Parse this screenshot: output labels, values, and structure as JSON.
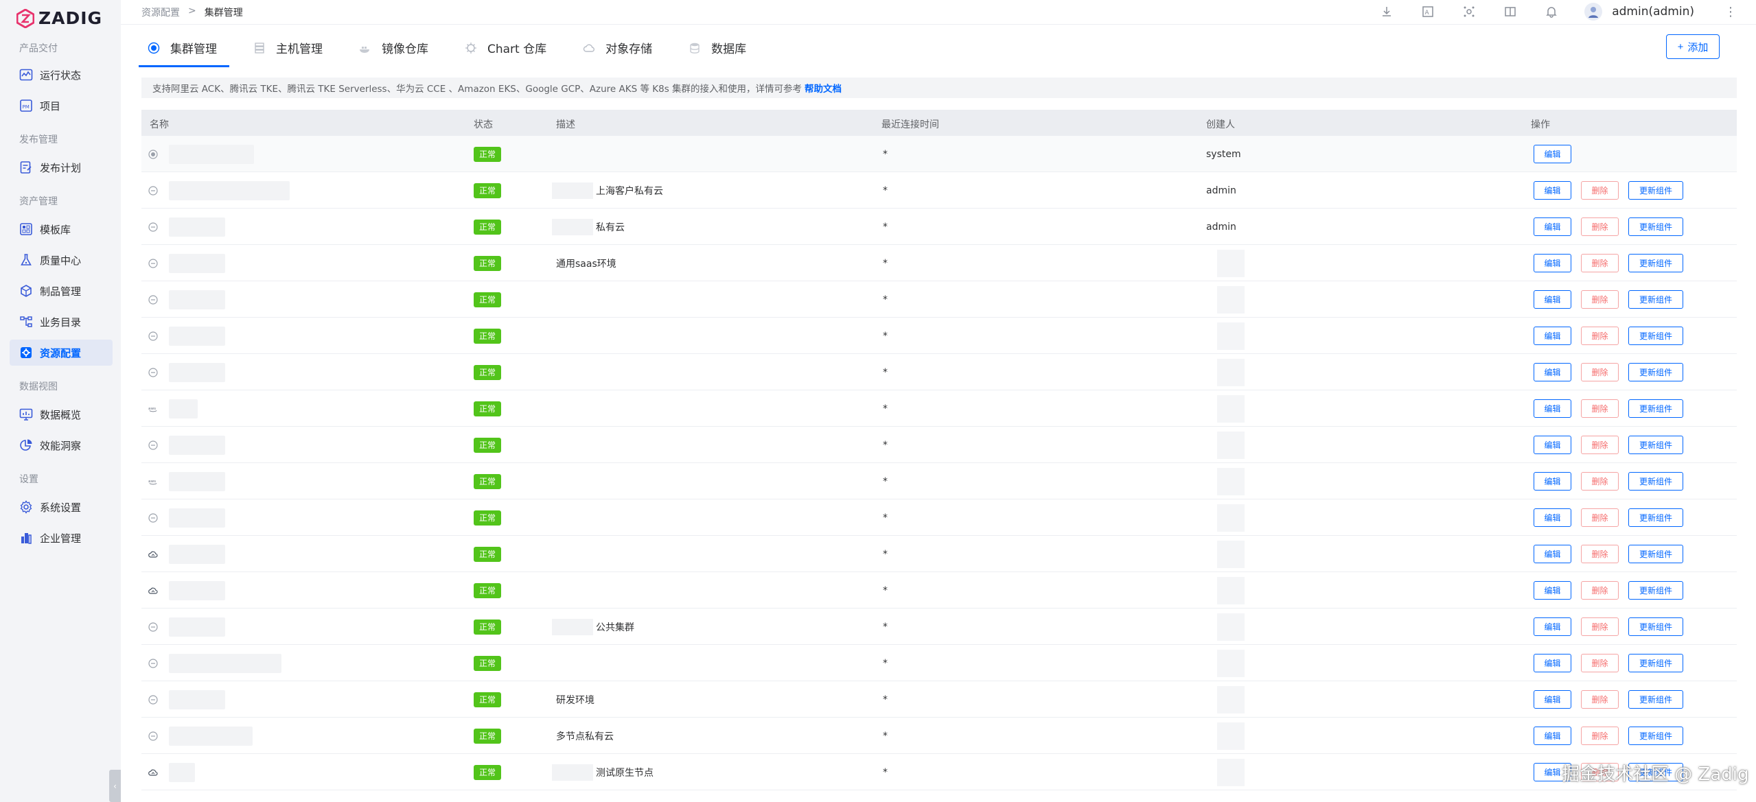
{
  "brand": {
    "name": "ZADIG"
  },
  "sidebar": {
    "sections": [
      {
        "label": "产品交付",
        "items": [
          {
            "label": "运行状态",
            "icon": "activity-icon"
          },
          {
            "label": "项目",
            "icon": "project-icon"
          }
        ]
      },
      {
        "label": "发布管理",
        "items": [
          {
            "label": "发布计划",
            "icon": "release-plan-icon"
          }
        ]
      },
      {
        "label": "资产管理",
        "items": [
          {
            "label": "模板库",
            "icon": "template-icon"
          },
          {
            "label": "质量中心",
            "icon": "flask-icon"
          },
          {
            "label": "制品管理",
            "icon": "artifact-icon"
          },
          {
            "label": "业务目录",
            "icon": "catalog-icon"
          },
          {
            "label": "资源配置",
            "icon": "gear-square-icon",
            "active": true
          }
        ]
      },
      {
        "label": "数据视图",
        "items": [
          {
            "label": "数据概览",
            "icon": "chart-bar-icon"
          },
          {
            "label": "效能洞察",
            "icon": "pie-chart-icon"
          }
        ]
      },
      {
        "label": "设置",
        "items": [
          {
            "label": "系统设置",
            "icon": "settings-icon"
          },
          {
            "label": "企业管理",
            "icon": "building-icon"
          }
        ]
      }
    ]
  },
  "breadcrumb": {
    "parent": "资源配置",
    "sep": ">",
    "current": "集群管理"
  },
  "topbar": {
    "user": "admin(admin)"
  },
  "tabs": [
    {
      "label": "集群管理",
      "icon": "cluster-icon",
      "active": true
    },
    {
      "label": "主机管理",
      "icon": "server-icon"
    },
    {
      "label": "镜像仓库",
      "icon": "registry-icon"
    },
    {
      "label": "Chart 仓库",
      "icon": "helm-icon"
    },
    {
      "label": "对象存储",
      "icon": "cloud-storage-icon"
    },
    {
      "label": "数据库",
      "icon": "database-icon"
    }
  ],
  "add_button": {
    "label": "添加"
  },
  "notice": {
    "text": "支持阿里云 ACK、腾讯云 TKE、腾讯云 TKE Serverless、华为云 CCE 、Amazon EKS、Google GCP、Azure AKS 等 K8s 集群的接入和使用，详情可参考",
    "link": "帮助文档"
  },
  "table": {
    "headers": [
      "名称",
      "状态",
      "描述",
      "最近连接时间",
      "创建人",
      "操作"
    ],
    "buttons": {
      "edit": "编辑",
      "delete": "删除",
      "update": "更新组件"
    },
    "rows": [
      {
        "type": "radio",
        "status": "正常",
        "desc": "",
        "desc_blur": false,
        "time": "*",
        "creator": "system",
        "actions": "edit"
      },
      {
        "type": "minus",
        "status": "正常",
        "desc": "上海客户私有云",
        "desc_blur": true,
        "time": "*",
        "creator": "admin",
        "actions": "all"
      },
      {
        "type": "minus",
        "status": "正常",
        "desc": "私有云",
        "desc_blur": true,
        "time": "*",
        "creator": "admin",
        "actions": "all"
      },
      {
        "type": "minus",
        "status": "正常",
        "desc": "通用saas环境",
        "desc_blur": false,
        "time": "*",
        "creator": "",
        "actions": "all"
      },
      {
        "type": "minus",
        "status": "正常",
        "desc": "",
        "desc_blur": false,
        "time": "*",
        "creator": "",
        "actions": "all"
      },
      {
        "type": "minus",
        "status": "正常",
        "desc": "",
        "desc_blur": false,
        "time": "*",
        "creator": "",
        "actions": "all"
      },
      {
        "type": "minus",
        "status": "正常",
        "desc": "",
        "desc_blur": false,
        "time": "*",
        "creator": "",
        "actions": "all"
      },
      {
        "type": "aws",
        "status": "正常",
        "desc": "",
        "desc_blur": false,
        "time": "*",
        "creator": "",
        "actions": "all"
      },
      {
        "type": "minus",
        "status": "正常",
        "desc": "",
        "desc_blur": false,
        "time": "*",
        "creator": "",
        "actions": "all"
      },
      {
        "type": "aws",
        "status": "正常",
        "desc": "",
        "desc_blur": false,
        "time": "*",
        "creator": "",
        "actions": "all"
      },
      {
        "type": "minus",
        "status": "正常",
        "desc": "",
        "desc_blur": false,
        "time": "*",
        "creator": "",
        "actions": "all"
      },
      {
        "type": "cloud",
        "status": "正常",
        "desc": "",
        "desc_blur": false,
        "time": "*",
        "creator": "",
        "actions": "all"
      },
      {
        "type": "cloud",
        "status": "正常",
        "desc": "",
        "desc_blur": false,
        "time": "*",
        "creator": "",
        "actions": "all"
      },
      {
        "type": "minus",
        "status": "正常",
        "desc": "公共集群",
        "desc_blur": true,
        "time": "*",
        "creator": "",
        "actions": "all"
      },
      {
        "type": "minus",
        "status": "正常",
        "desc": "",
        "desc_blur": false,
        "time": "*",
        "creator": "",
        "actions": "all"
      },
      {
        "type": "minus",
        "status": "正常",
        "desc": "研发环境",
        "desc_blur": false,
        "time": "*",
        "creator": "",
        "actions": "all"
      },
      {
        "type": "minus",
        "status": "正常",
        "desc": "多节点私有云",
        "desc_blur": false,
        "time": "*",
        "creator": "",
        "actions": "all"
      },
      {
        "type": "cloud",
        "status": "正常",
        "desc": "测试原生节点",
        "desc_blur": true,
        "time": "*",
        "creator": "",
        "actions": "all"
      }
    ]
  },
  "watermark": "掘金技术社区 @ Zadig",
  "colors": {
    "accent": "#0066ff",
    "status_ok": "#52c41a",
    "danger": "#f56c6c"
  }
}
